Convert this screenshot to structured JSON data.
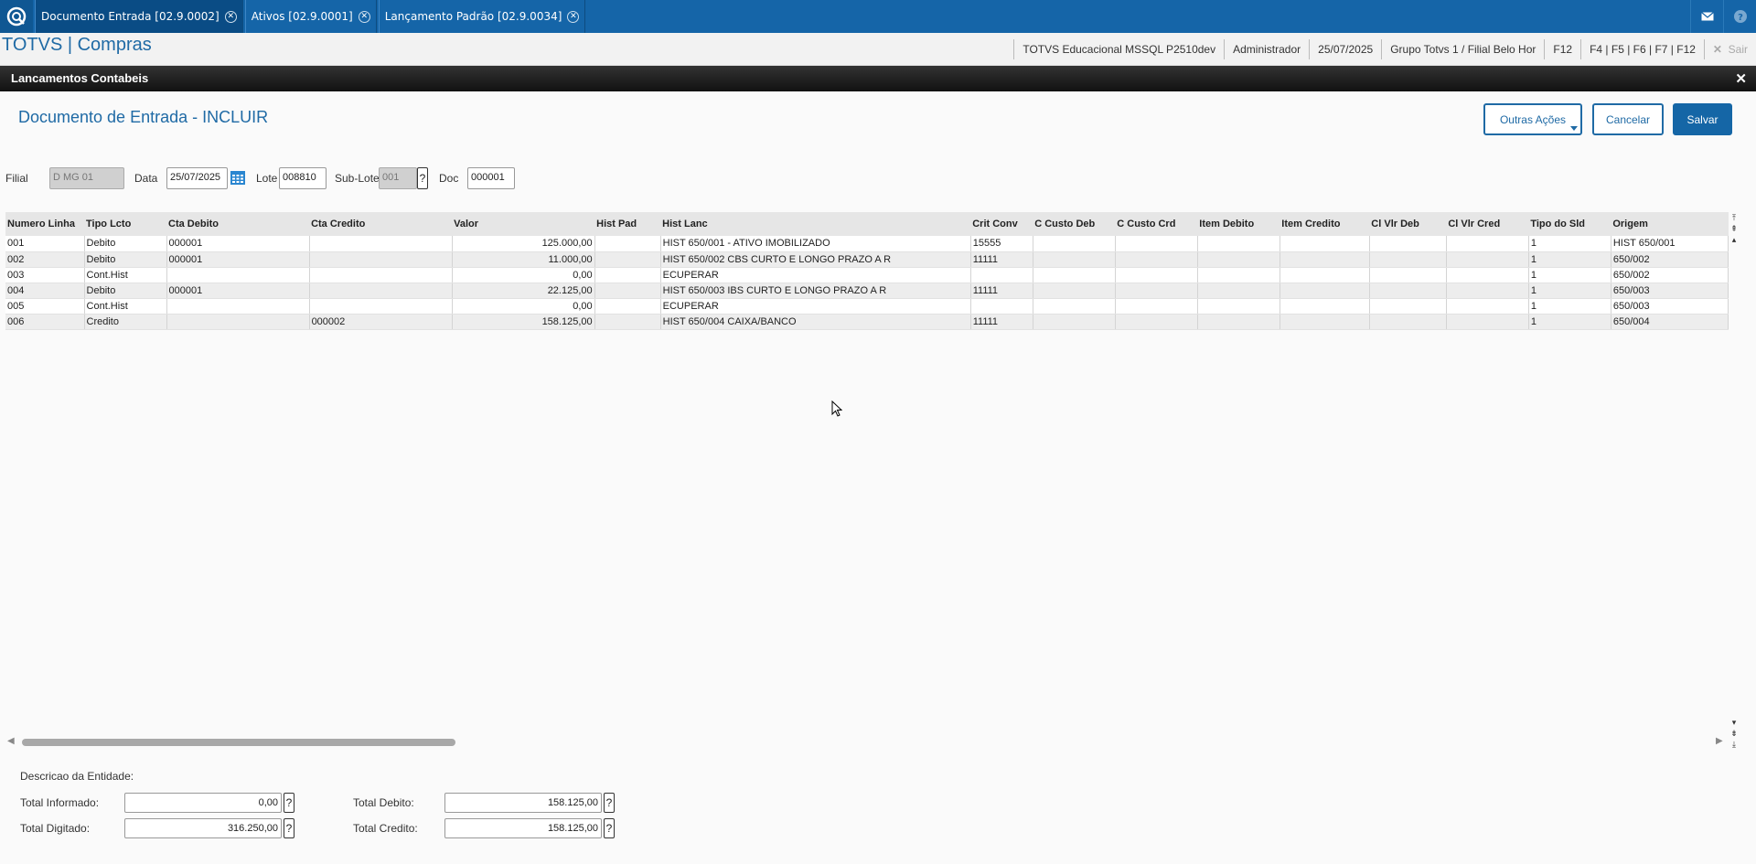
{
  "topbar": {
    "tabs": [
      {
        "label": "Documento Entrada [02.9.0002]",
        "active": true
      },
      {
        "label": "Ativos [02.9.0001]",
        "active": false
      },
      {
        "label": "Lançamento Padrão [02.9.0034]",
        "active": false
      }
    ],
    "icons": [
      "mail-icon",
      "help-icon"
    ]
  },
  "header": {
    "app_title": "TOTVS | Compras",
    "environment": "TOTVS Educacional MSSQL P2510dev",
    "user": "Administrador",
    "date": "25/07/2025",
    "branch": "Grupo Totvs 1 / Filial Belo Hor",
    "f12": "F12",
    "shortcuts": "F4 | F5 | F6 | F7 | F12",
    "exit": "Sair"
  },
  "dialog": {
    "title": "Lancamentos Contabeis",
    "page_title": "Documento de Entrada - INCLUIR",
    "buttons": {
      "more": "Outras Ações",
      "cancel": "Cancelar",
      "save": "Salvar"
    }
  },
  "form": {
    "filial_label": "Filial",
    "filial_value": "D MG 01",
    "data_label": "Data",
    "data_value": "25/07/2025",
    "lote_label": "Lote",
    "lote_value": "008810",
    "sublote_label": "Sub-Lote",
    "sublote_value": "001",
    "doc_label": "Doc",
    "doc_value": "000001"
  },
  "grid": {
    "columns": [
      "Numero Linha",
      "Tipo Lcto",
      "Cta Debito",
      "Cta Credito",
      "Valor",
      "Hist Pad",
      "Hist Lanc",
      "Crit Conv",
      "C Custo Deb",
      "C Custo Crd",
      "Item Debito",
      "Item Credito",
      "Cl Vlr Deb",
      "Cl Vlr Cred",
      "Tipo do Sld",
      "Origem"
    ],
    "rows": [
      [
        "001",
        "Debito",
        "000001",
        "",
        "125.000,00",
        "",
        "HIST 650/001 - ATIVO IMOBILIZADO",
        "15555",
        "",
        "",
        "",
        "",
        "",
        "",
        "1",
        "HIST 650/001"
      ],
      [
        "002",
        "Debito",
        "000001",
        "",
        "11.000,00",
        "",
        "HIST 650/002 CBS CURTO E LONGO PRAZO A R",
        "11111",
        "",
        "",
        "",
        "",
        "",
        "",
        "1",
        "650/002"
      ],
      [
        "003",
        "Cont.Hist",
        "",
        "",
        "0,00",
        "",
        "ECUPERAR",
        "",
        "",
        "",
        "",
        "",
        "",
        "",
        "1",
        "650/002"
      ],
      [
        "004",
        "Debito",
        "000001",
        "",
        "22.125,00",
        "",
        "HIST 650/003 IBS CURTO E LONGO PRAZO A R",
        "11111",
        "",
        "",
        "",
        "",
        "",
        "",
        "1",
        "650/003"
      ],
      [
        "005",
        "Cont.Hist",
        "",
        "",
        "0,00",
        "",
        "ECUPERAR",
        "",
        "",
        "",
        "",
        "",
        "",
        "",
        "1",
        "650/003"
      ],
      [
        "006",
        "Credito",
        "",
        "000002",
        "158.125,00",
        "",
        "HIST 650/004 CAIXA/BANCO",
        "11111",
        "",
        "",
        "",
        "",
        "",
        "",
        "1",
        "650/004"
      ]
    ]
  },
  "totals": {
    "entity_label": "Descricao da Entidade:",
    "informado_label": "Total Informado:",
    "informado_value": "0,00",
    "digitado_label": "Total Digitado:",
    "digitado_value": "316.250,00",
    "debito_label": "Total Debito:",
    "debito_value": "158.125,00",
    "credito_label": "Total Credito:",
    "credito_value": "158.125,00"
  },
  "colors": {
    "brand": "#1565a8",
    "accent": "#1f6aa5"
  }
}
